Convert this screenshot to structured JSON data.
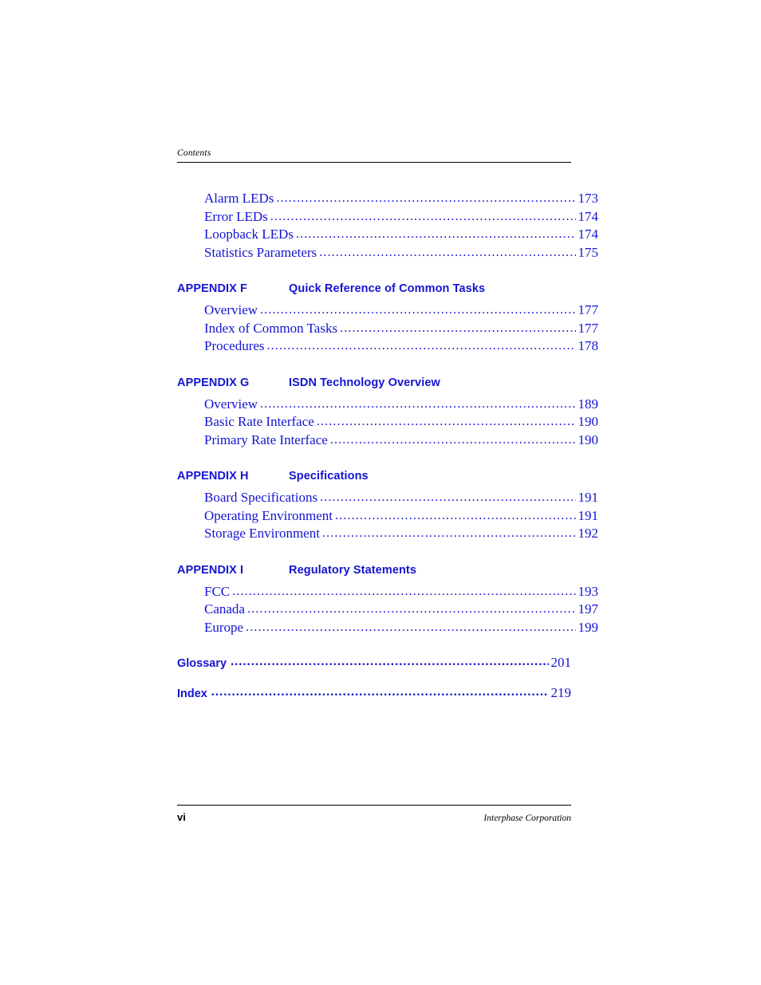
{
  "header": {
    "label": "Contents"
  },
  "toc": {
    "top_entries": [
      {
        "label": "Alarm LEDs",
        "page": "173"
      },
      {
        "label": "Error LEDs",
        "page": "174"
      },
      {
        "label": "Loopback LEDs",
        "page": "174"
      },
      {
        "label": "Statistics Parameters",
        "page": "175"
      }
    ],
    "appendices": [
      {
        "tag": "APPENDIX F",
        "title": "Quick Reference of Common Tasks",
        "entries": [
          {
            "label": "Overview",
            "page": "177"
          },
          {
            "label": "Index of Common Tasks",
            "page": "177"
          },
          {
            "label": "Procedures",
            "page": "178"
          }
        ]
      },
      {
        "tag": "APPENDIX G",
        "title": "ISDN Technology Overview",
        "entries": [
          {
            "label": "Overview",
            "page": "189"
          },
          {
            "label": "Basic Rate Interface",
            "page": "190"
          },
          {
            "label": "Primary Rate Interface",
            "page": "190"
          }
        ]
      },
      {
        "tag": "APPENDIX H",
        "title": "Specifications",
        "entries": [
          {
            "label": "Board Specifications",
            "page": "191"
          },
          {
            "label": "Operating Environment",
            "page": "191"
          },
          {
            "label": "Storage Environment",
            "page": "192"
          }
        ]
      },
      {
        "tag": "APPENDIX I",
        "title": "Regulatory Statements",
        "entries": [
          {
            "label": "FCC",
            "page": "193"
          },
          {
            "label": "Canada",
            "page": "197"
          },
          {
            "label": "Europe",
            "page": "199"
          }
        ]
      }
    ],
    "major_entries": [
      {
        "label": "Glossary",
        "page": "201"
      },
      {
        "label": "Index",
        "page": "219"
      }
    ],
    "dot_leader": "............................................................................................................................................................"
  },
  "footer": {
    "page_number": "vi",
    "company": "Interphase Corporation"
  },
  "colors": {
    "link_blue": "#1414d2",
    "text_black": "#000000"
  }
}
